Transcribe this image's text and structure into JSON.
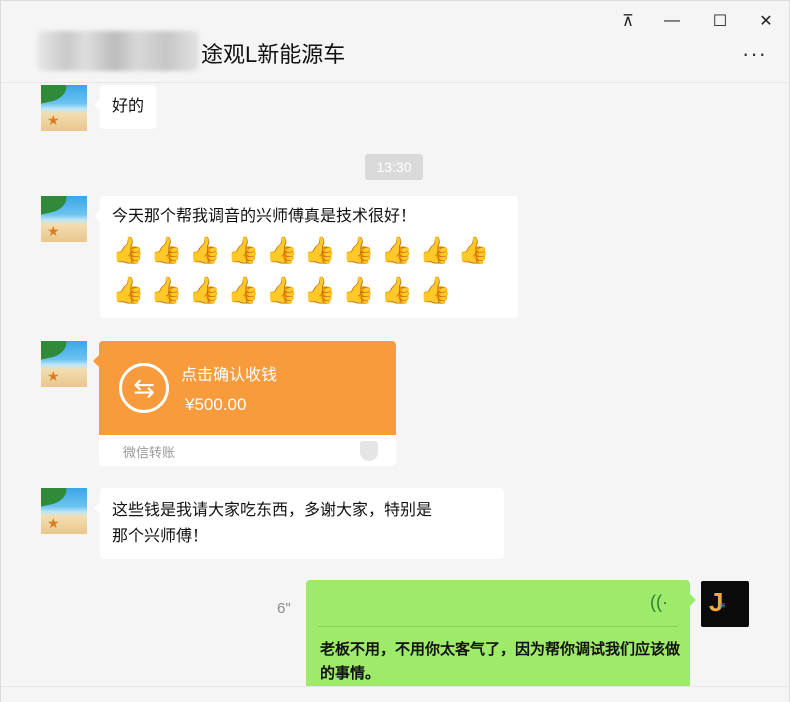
{
  "window": {
    "title": "途观L新能源车",
    "controls": {
      "pin": "⊼",
      "minimize": "—",
      "maximize": "☐",
      "close": "✕"
    },
    "more_label": "···"
  },
  "messages": {
    "m1": {
      "text": "好的"
    },
    "timestamp": "13:30",
    "m2": {
      "text": "今天那个帮我调音的兴师傅真是技术很好！",
      "thumbs_row1": "👍👍👍👍👍👍👍👍👍👍",
      "thumbs_row2": "👍👍👍👍👍👍👍👍👍"
    },
    "transfer": {
      "title": "点击确认收钱",
      "amount": "¥500.00",
      "label": "微信转账",
      "icon": "⇆"
    },
    "m4": {
      "line1": "这些钱是我请大家吃东西，多谢大家，特别是",
      "line2": "那个兴师傅！"
    },
    "voice": {
      "duration": "6\"",
      "transcript": "老板不用，不用你太客气了，因为帮你调试我们应该做的事情。"
    }
  }
}
